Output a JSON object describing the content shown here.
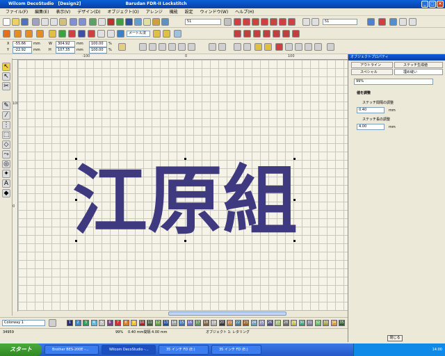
{
  "window": {
    "app": "Wilcom DecoStudio",
    "doc": "[Design2]",
    "machine": "Barudan FDR-II Lockstitch"
  },
  "menu": [
    "ファイル(F)",
    "編集(E)",
    "表示(V)",
    "デザイン(D)",
    "オブジェクト(O)",
    "アレンジ",
    "機能",
    "設定",
    "ウィンドウ(W)",
    "ヘルプ(H)"
  ],
  "toolbar": {
    "stitch_combo": "メートル法",
    "field1": "51",
    "field2": "51"
  },
  "props": {
    "x_label": "X",
    "x": "-55.66",
    "y_label": "Y",
    "y": "-22.92",
    "w_label": "W",
    "w": "304.92",
    "h_label": "H",
    "h": "107.35",
    "unit": "mm",
    "sx": "100.00",
    "sy": "100.00",
    "pct": "%"
  },
  "ruler": {
    "top": [
      "-100",
      "0",
      "100"
    ],
    "left": [
      "100",
      "0"
    ]
  },
  "design_text": "江原組",
  "design_color": "#3f3a80",
  "colorway": {
    "label": "Colorway 1"
  },
  "swatches": [
    "1",
    "2",
    "3",
    "4",
    "5",
    "6",
    "7",
    "8",
    "9",
    "10",
    "11",
    "12",
    "13",
    "14",
    "15",
    "16",
    "17",
    "18",
    "19",
    "20",
    "21",
    "22",
    "23",
    "24",
    "25",
    "26",
    "27",
    "28",
    "29",
    "30",
    "31",
    "32",
    "33",
    "34",
    "35"
  ],
  "swatch_colors": [
    "#2a2a7a",
    "#2e8bd0",
    "#2fa05a",
    "#64b9e0",
    "#c0c0c0",
    "#8a3a8a",
    "#d03030",
    "#e07a20",
    "#f0c020",
    "#b02020",
    "#406040",
    "#60a040",
    "#2050a0",
    "#a0a0a0",
    "#3a7ac0",
    "#7070c0",
    "#5a9a5a",
    "#806040",
    "#b0b0b0",
    "#3a3a3a",
    "#c08040",
    "#4080a0",
    "#a06020",
    "#70a0c0",
    "#9090c0",
    "#505080",
    "#a0c070",
    "#707070",
    "#c0c040",
    "#40a080",
    "#8080a0",
    "#60c060",
    "#a0a040",
    "#d0a030",
    "#306030"
  ],
  "status": {
    "count": "34959",
    "zoom": "99%",
    "info": "0.40 mm間隔  4.00 mm",
    "object": "オブジェクト 1: レタリング"
  },
  "panel": {
    "title": "オブジェクトプロパティ",
    "tabs": [
      "アウトライン",
      "ステッチ生成値",
      "スペシャル",
      "埋め縫い"
    ],
    "dropdown": "99%",
    "section": "値を調整",
    "spacing_label": "ステッチ間隔の調整",
    "spacing_value": "0.40",
    "length_label": "ステッチ長の調整",
    "length_value": "4.00",
    "unit": "mm",
    "close": "閉じる"
  },
  "taskbar": {
    "start": "スタート",
    "tasks": [
      "Brother BES-200E -...",
      "Wilcom DecoStudio -...",
      "35 インチ FD (E:)",
      "35 インチ FD (E:)"
    ],
    "clock": "14:00"
  }
}
